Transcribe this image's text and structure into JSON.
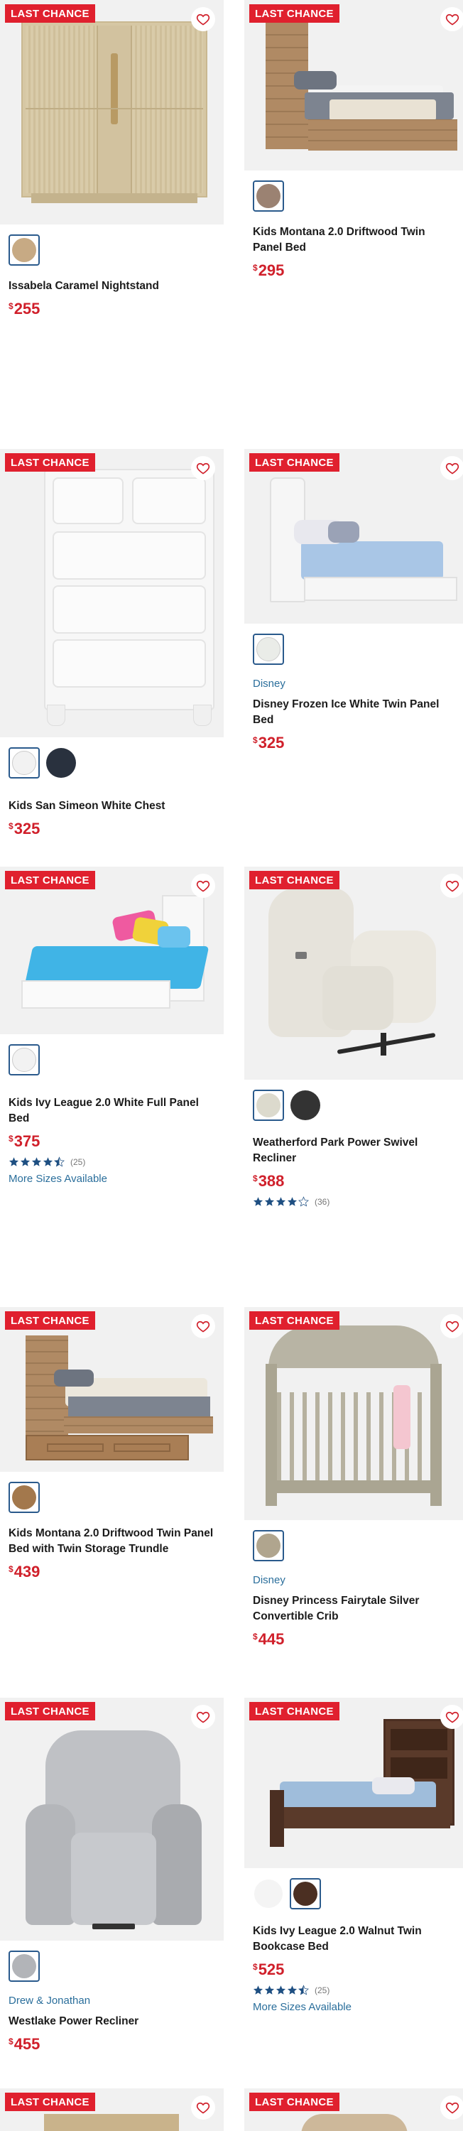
{
  "badge_text": "LAST CHANCE",
  "colors": {
    "badge": "#e0202e",
    "price": "#d0202b",
    "link": "#2a6e9b",
    "star": "#1e4f82"
  },
  "products": [
    {
      "title": "Issabela Caramel Nightstand",
      "price": "255",
      "currency": "$",
      "swatches": [
        "#c7aa84"
      ]
    },
    {
      "title": "Kids Montana 2.0 Driftwood Twin Panel Bed",
      "price": "295",
      "currency": "$",
      "swatches": [
        "#9b8272"
      ]
    },
    {
      "title": "Kids San Simeon White Chest",
      "price": "325",
      "currency": "$",
      "swatches": [
        "#f2f2f2",
        "#29313e"
      ]
    },
    {
      "brand": "Disney",
      "title": "Disney Frozen Ice White Twin Panel Bed",
      "price": "325",
      "currency": "$",
      "swatches": [
        "#eaece8"
      ]
    },
    {
      "title": "Kids Ivy League 2.0 White Full Panel Bed",
      "price": "375",
      "currency": "$",
      "swatches": [
        "#f2f2f2"
      ],
      "rating": 4.5,
      "review_count": "(25)",
      "more": "More Sizes Available"
    },
    {
      "title": "Weatherford Park Power Swivel Recliner",
      "price": "388",
      "currency": "$",
      "swatches": [
        "#dcdacd",
        "#333333"
      ],
      "rating": 4,
      "review_count": "(36)"
    },
    {
      "title": "Kids Montana 2.0 Driftwood Twin Panel Bed with Twin Storage Trundle",
      "price": "439",
      "currency": "$",
      "swatches": [
        "#a3784c"
      ]
    },
    {
      "brand": "Disney",
      "title": "Disney Princess Fairytale Silver Convertible Crib",
      "price": "445",
      "currency": "$",
      "swatches": [
        "#b0a58e"
      ]
    },
    {
      "brand": "Drew & Jonathan",
      "title": "Westlake Power Recliner",
      "price": "455",
      "currency": "$",
      "swatches": [
        "#b2b4b8"
      ]
    },
    {
      "title": "Kids Ivy League 2.0 Walnut Twin Bookcase Bed",
      "price": "525",
      "currency": "$",
      "swatches": [
        "#f4f4f4",
        "#4b2f22"
      ],
      "rating": 4.5,
      "review_count": "(25)",
      "more": "More Sizes Available"
    }
  ]
}
